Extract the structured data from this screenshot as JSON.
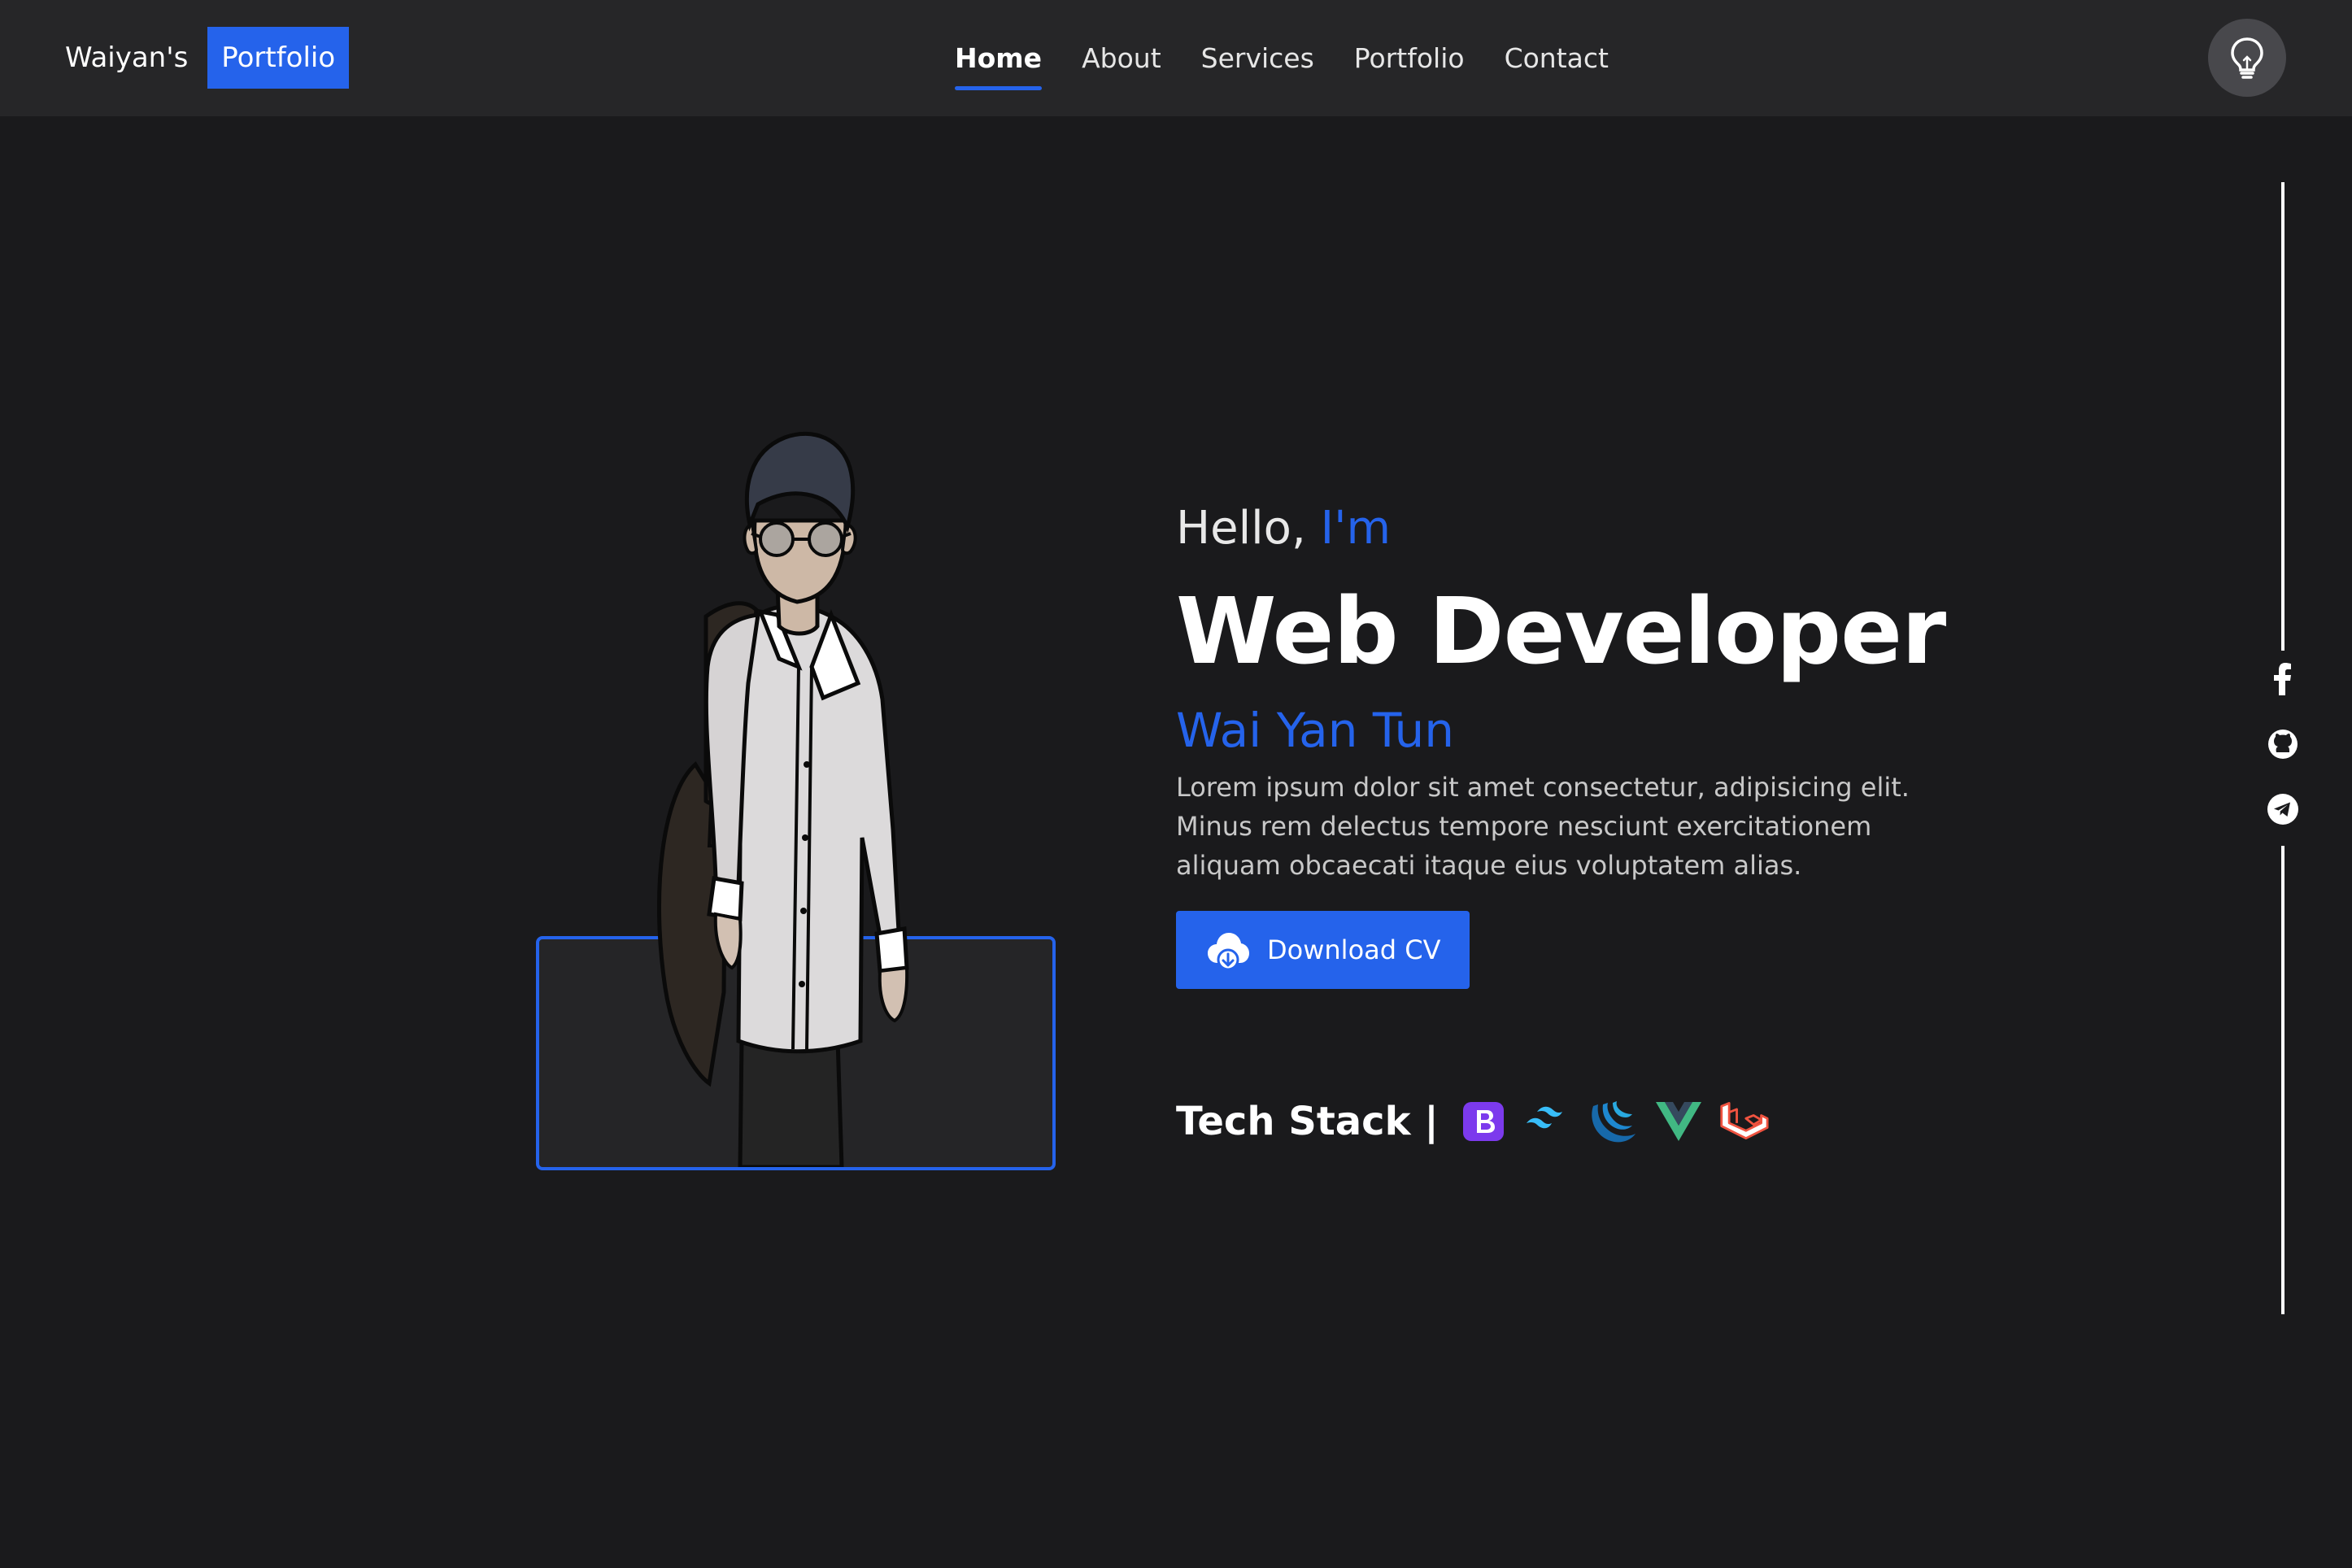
{
  "navbar": {
    "brand_name": "Waiyan's",
    "brand_tag": "Portfolio",
    "links": [
      {
        "label": "Home",
        "active": true
      },
      {
        "label": "About",
        "active": false
      },
      {
        "label": "Services",
        "active": false
      },
      {
        "label": "Portfolio",
        "active": false
      },
      {
        "label": "Contact",
        "active": false
      }
    ],
    "theme_toggle_icon": "lightbulb-icon"
  },
  "social": [
    {
      "icon": "facebook-icon"
    },
    {
      "icon": "github-icon"
    },
    {
      "icon": "telegram-icon"
    }
  ],
  "hero": {
    "greeting_prefix": "Hello,",
    "greeting_accent": "I'm",
    "headline": "Web Developer",
    "name": "Wai Yan Tun",
    "bio": "Lorem ipsum dolor sit amet consectetur, adipisicing elit. Minus rem delectus tempore nesciunt exercitationem aliquam obcaecati itaque eius voluptatem alias.",
    "cv_button": {
      "label": "Download CV",
      "icon": "cloud-download-icon"
    },
    "tech_stack_label": "Tech Stack |",
    "tech_icons": [
      "bootstrap-icon",
      "tailwind-icon",
      "jquery-icon",
      "vue-icon",
      "laravel-icon"
    ]
  },
  "colors": {
    "accent": "#2563eb",
    "background": "#1a1a1c",
    "navbar": "#262628"
  }
}
